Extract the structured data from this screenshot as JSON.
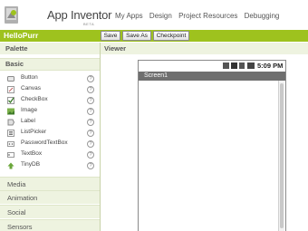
{
  "app": {
    "name": "App Inventor",
    "beta": "BETA"
  },
  "topnav": [
    "My Apps",
    "Design",
    "Project Resources",
    "Debugging"
  ],
  "project": {
    "name": "HelloPurr",
    "buttons": {
      "save": "Save",
      "save_as": "Save As",
      "checkpoint": "Checkpoint"
    }
  },
  "palette": {
    "title": "Palette",
    "open_category": "Basic",
    "components": [
      {
        "label": "Button",
        "icon": "button-icon"
      },
      {
        "label": "Canvas",
        "icon": "canvas-icon"
      },
      {
        "label": "CheckBox",
        "icon": "checkbox-icon"
      },
      {
        "label": "Image",
        "icon": "image-icon"
      },
      {
        "label": "Label",
        "icon": "label-icon"
      },
      {
        "label": "ListPicker",
        "icon": "listpicker-icon"
      },
      {
        "label": "PasswordTextBox",
        "icon": "password-icon"
      },
      {
        "label": "TextBox",
        "icon": "textbox-icon"
      },
      {
        "label": "TinyDB",
        "icon": "tinydb-icon"
      }
    ],
    "help_glyph": "?",
    "categories": [
      "Media",
      "Animation",
      "Social",
      "Sensors"
    ]
  },
  "viewer": {
    "title": "Viewer",
    "clock": "5:09 PM",
    "screen_title": "Screen1"
  },
  "colors": {
    "accent_green": "#9ec21e",
    "section_bg": "#eef3e0"
  }
}
